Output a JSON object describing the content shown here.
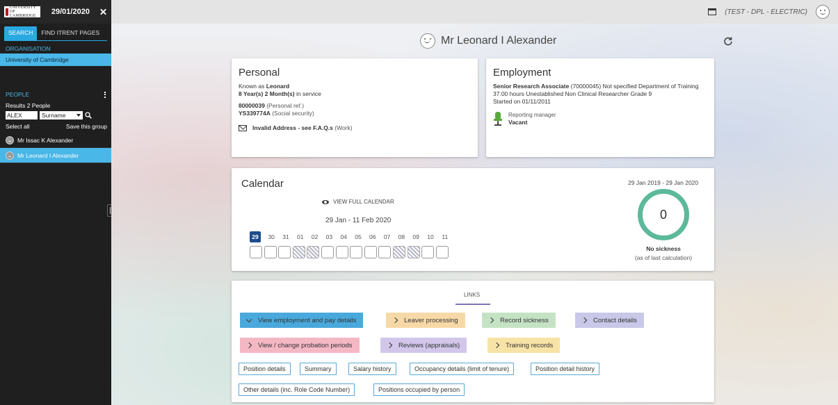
{
  "sidebar": {
    "logo_text": "UNIVERSITY OF CAMBRIDGE",
    "date": "29/01/2020",
    "tabs": [
      "SEARCH",
      "FIND ITRENT PAGES"
    ],
    "organisation_heading": "ORGANISATION",
    "organisation_value": "University of Cambridge",
    "people_heading": "PEOPLE",
    "results": "Results 2 People",
    "search_query": "ALEX",
    "search_field": "Surname",
    "select_all": "Select all",
    "save_group": "Save this group",
    "people": [
      "Mr Issac K Alexander",
      "Mr Leonard I Alexander"
    ]
  },
  "topbar": {
    "environment": "(TEST - DPL - ELECTRIC)"
  },
  "header": {
    "person_name": "Mr Leonard I Alexander"
  },
  "personal": {
    "title": "Personal",
    "known_as_label": "Known as",
    "known_as": "Leonard",
    "service_value": "8 Year(s) 2 Month(s)",
    "service_suffix": "in service",
    "personal_ref": "80000039",
    "personal_ref_label": "(Personal ref.)",
    "social_security": "YS339774A",
    "social_security_label": "(Social security)",
    "address": "Invalid Address - see F.A.Q.s",
    "address_suffix": "(Work)"
  },
  "employment": {
    "title": "Employment",
    "job_title": "Senior Research Associate",
    "job_detail": "(70000045) Not specified Department of Training",
    "hours": "37.00 hours Unestablished Non Clinical Researcher Grade 9",
    "started": "Started on 01/11/2011",
    "manager_label": "Reporting manager",
    "manager_value": "Vacant"
  },
  "calendar": {
    "title": "Calendar",
    "view_full": "VIEW FULL CALENDAR",
    "range": "29 Jan - 11 Feb 2020",
    "days": [
      "29",
      "30",
      "31",
      "01",
      "02",
      "03",
      "04",
      "05",
      "06",
      "07",
      "08",
      "09",
      "10",
      "11"
    ],
    "hatched_days": [
      3,
      4,
      10,
      11
    ],
    "sickness_range": "29 Jan 2019 - 29 Jan 2020",
    "sickness_count": "0",
    "sickness_label": "No sickness",
    "sickness_note": "(as of last calculation)"
  },
  "links": {
    "title": "LINKS",
    "pills": [
      {
        "label": "View employment and pay details",
        "color": "#4aa9dc",
        "expanded": true
      },
      {
        "label": "Leaver processing",
        "color": "#f7d9a7",
        "expanded": false
      },
      {
        "label": "Record sickness",
        "color": "#c5e3c4",
        "expanded": false
      },
      {
        "label": "Contact details",
        "color": "#c9c8e8",
        "expanded": false
      },
      {
        "label": "View / change probation periods",
        "color": "#f4b8c4",
        "expanded": false
      },
      {
        "label": "Reviews (appraisals)",
        "color": "#d2c7ea",
        "expanded": false
      },
      {
        "label": "Training records",
        "color": "#f8e3a6",
        "expanded": false
      }
    ],
    "sublinks": [
      "Position details",
      "Summary",
      "Salary history",
      "Occupancy details (limit of tenure)",
      "Position detail history",
      "Other details (inc. Role Code Number)",
      "Positions occupied by person"
    ]
  }
}
